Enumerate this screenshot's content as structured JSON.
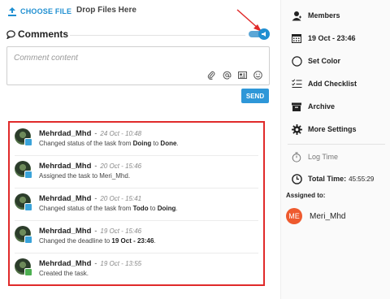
{
  "upload": {
    "choose_file_label": "CHOOSE FILE",
    "drop_label": "Drop Files Here"
  },
  "comments": {
    "title": "Comments",
    "placeholder": "Comment content",
    "send_label": "SEND",
    "toggle_on": true,
    "tools": [
      "paperclip-icon",
      "at-icon",
      "card-icon",
      "smile-icon"
    ]
  },
  "activity": [
    {
      "user": "Mehrdad_Mhd",
      "sep": "-",
      "time": "24 Oct - 10:48",
      "text_pre": "Changed status of the task from ",
      "b1": "Doing",
      "text_mid": " to ",
      "b2": "Done",
      "text_post": ".",
      "badge": "blue"
    },
    {
      "user": "Mehrdad_Mhd",
      "sep": "-",
      "time": "20 Oct - 15:46",
      "text_pre": "Assigned the task to Meri_Mhd.",
      "b1": "",
      "text_mid": "",
      "b2": "",
      "text_post": "",
      "badge": "blue"
    },
    {
      "user": "Mehrdad_Mhd",
      "sep": "-",
      "time": "20 Oct - 15:41",
      "text_pre": "Changed status of the task from ",
      "b1": "Todo",
      "text_mid": " to ",
      "b2": "Doing",
      "text_post": ".",
      "badge": "blue"
    },
    {
      "user": "Mehrdad_Mhd",
      "sep": "-",
      "time": "19 Oct - 15:46",
      "text_pre": "Changed the deadline to ",
      "b1": "19 Oct - 23:46",
      "text_mid": "",
      "b2": "",
      "text_post": ".",
      "badge": "blue"
    },
    {
      "user": "Mehrdad_Mhd",
      "sep": "-",
      "time": "19 Oct - 13:55",
      "text_pre": "Created the task.",
      "b1": "",
      "text_mid": "",
      "b2": "",
      "text_post": "",
      "badge": "green"
    }
  ],
  "sidebar": {
    "members": "Members",
    "deadline": "19 Oct - 23:46",
    "set_color": "Set Color",
    "add_checklist": "Add Checklist",
    "archive": "Archive",
    "more_settings": "More Settings",
    "log_time": "Log Time",
    "total_time_label": "Total Time:",
    "total_time_value": "45:55:29",
    "assigned_to_label": "Assigned to:",
    "assignee_initials": "ME",
    "assignee_name": "Meri_Mhd"
  },
  "colors": {
    "accent": "#2e97d8",
    "highlight_border": "#e02a2a",
    "assignee_avatar": "#ee5a2e"
  }
}
